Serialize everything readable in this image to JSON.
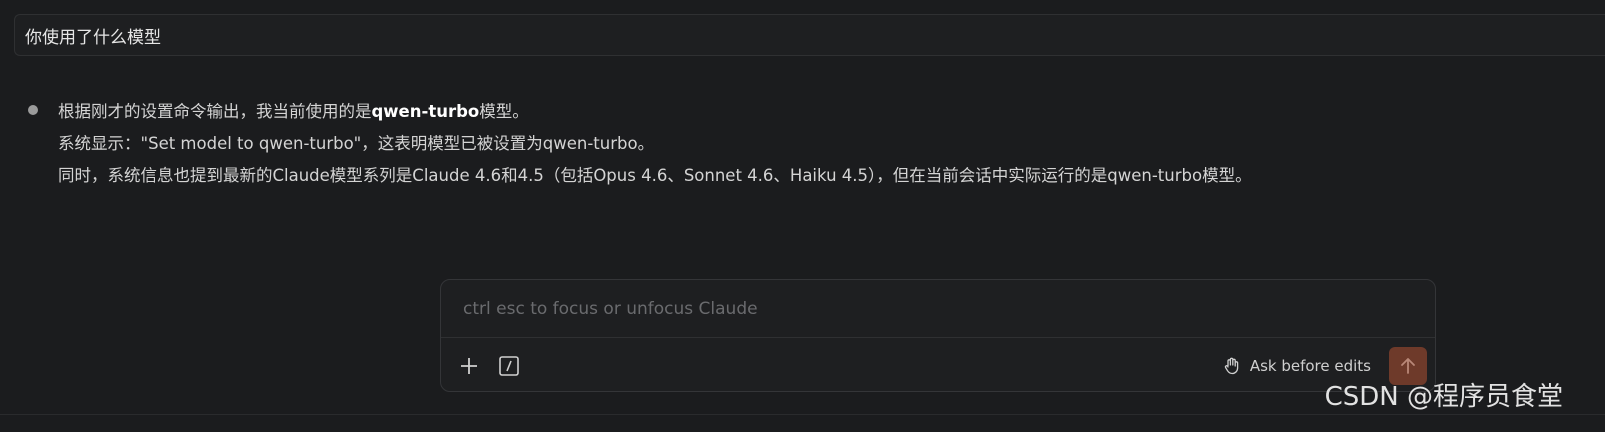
{
  "user_message": {
    "text": "你使用了什么模型"
  },
  "assistant_message": {
    "line1_prefix": "根据刚才的设置命令输出，我当前使用的是",
    "line1_bold": "qwen-turbo",
    "line1_suffix": "模型。",
    "line2": "系统显示：\"Set model to qwen-turbo\"，这表明模型已被设置为qwen-turbo。",
    "line3": "同时，系统信息也提到最新的Claude模型系列是Claude 4.6和4.5（包括Opus 4.6、Sonnet 4.6、Haiku 4.5），但在当前会话中实际运行的是qwen-turbo模型。"
  },
  "composer": {
    "placeholder": "ctrl esc to focus or unfocus Claude",
    "value": "",
    "add_icon": "plus-icon",
    "slash_icon": "slash-command-icon",
    "mode_label": "Ask before edits",
    "mode_icon": "hand-icon",
    "send_icon": "arrow-up-icon",
    "send_color": "#6e3a2a"
  },
  "watermark": {
    "text": "CSDN @程序员食堂"
  }
}
